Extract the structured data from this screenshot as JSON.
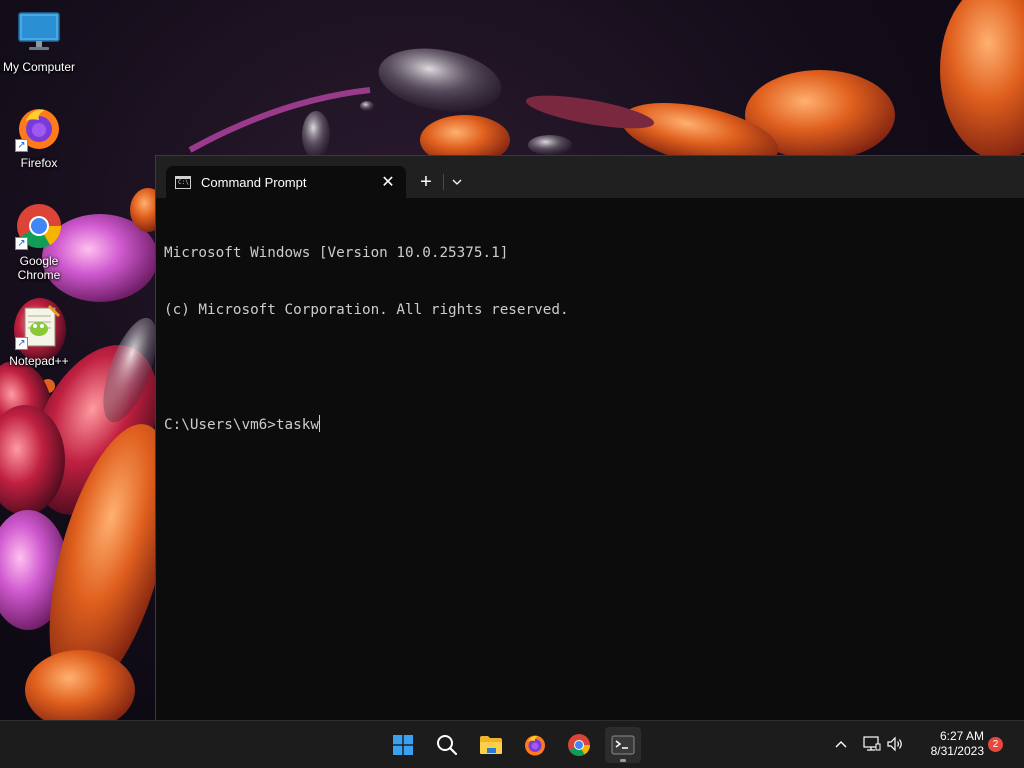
{
  "desktop": {
    "icons": [
      {
        "label": "My Computer",
        "icon": "monitor-icon"
      },
      {
        "label": "Firefox",
        "icon": "firefox-icon"
      },
      {
        "label": "Google Chrome",
        "icon": "chrome-icon"
      },
      {
        "label": "Notepad++",
        "icon": "notepadpp-icon"
      }
    ]
  },
  "terminal": {
    "tab_title": "Command Prompt",
    "tab_icon": "cmd-icon",
    "tab_icon_text": "C:\\",
    "new_tab_symbol": "+",
    "close_symbol": "✕",
    "lines": [
      "Microsoft Windows [Version 10.0.25375.1]",
      "(c) Microsoft Corporation. All rights reserved.",
      "",
      "C:\\Users\\vm6>taskw"
    ],
    "background_color": "#0c0c0c",
    "text_color": "#cccccc"
  },
  "taskbar": {
    "apps": [
      {
        "name": "Start",
        "icon": "windows-start-icon"
      },
      {
        "name": "Search",
        "icon": "search-icon"
      },
      {
        "name": "File Explorer",
        "icon": "folder-icon"
      },
      {
        "name": "Firefox",
        "icon": "firefox-icon"
      },
      {
        "name": "Google Chrome",
        "icon": "chrome-icon"
      },
      {
        "name": "Terminal",
        "icon": "terminal-icon",
        "active": true
      }
    ],
    "tray": {
      "overflow_icon": "chevron-up-icon",
      "network_icon": "network-icon",
      "volume_icon": "volume-icon"
    },
    "clock": {
      "time": "6:27 AM",
      "date": "8/31/2023"
    },
    "notification_count": "2"
  }
}
